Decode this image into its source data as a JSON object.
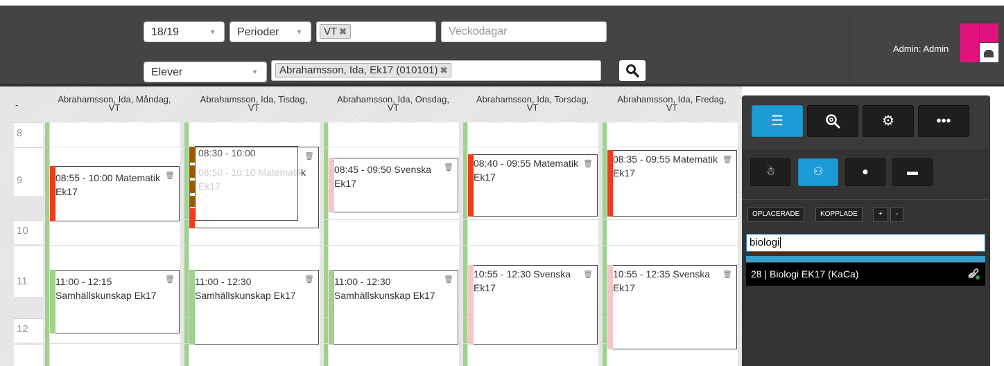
{
  "header": {
    "year_select": "18/19",
    "period_select": "Perioder",
    "period_tag": "VT",
    "weekdays_placeholder": "Veckodagar",
    "group_select": "Elever",
    "student_tag": "Abrahamsson, Ida, Ek17 (010101)",
    "admin_label": "Admin: Admin"
  },
  "calendar": {
    "corner": "-",
    "days": [
      {
        "header_line1": "Abrahamsson, Ida, Måndag,",
        "header_line2": "VT"
      },
      {
        "header_line1": "Abrahamsson, Ida, Tisdag,",
        "header_line2": "VT"
      },
      {
        "header_line1": "Abrahamsson, Ida, Onsdag,",
        "header_line2": "VT"
      },
      {
        "header_line1": "Abrahamsson, Ida, Torsdag,",
        "header_line2": "VT"
      },
      {
        "header_line1": "Abrahamsson, Ida, Fredag,",
        "header_line2": "VT"
      }
    ],
    "hours": [
      "8",
      "9",
      "10",
      "11",
      "12"
    ],
    "events": {
      "mon_1": {
        "line1": "08:55 - 10:00 Matematik",
        "line2": "Ek17"
      },
      "mon_2": {
        "line1": "11:00 - 12:15",
        "line2": "Samhällskunskap Ek17"
      },
      "tue_drag": {
        "line1": "08:30 - 10:00"
      },
      "tue_1": {
        "line1": "08:50 - 10:10 Matematik",
        "line2": "Ek17",
        "overflow": "k"
      },
      "tue_2": {
        "line1": "11:00 - 12:30",
        "line2": "Samhällskunskap Ek17"
      },
      "wed_1": {
        "line1": "08:45 - 09:50 Svenska",
        "line2": "Ek17"
      },
      "wed_2": {
        "line1": "11:00 - 12:30",
        "line2": "Samhällskunskap Ek17"
      },
      "thu_1": {
        "line1": "08:40 - 09:55 Matematik",
        "line2": "Ek17"
      },
      "thu_2": {
        "line1": "10:55 - 12:30 Svenska",
        "line2": "Ek17"
      },
      "fri_1": {
        "line1": "08:35 - 09:55 Matematik",
        "line2": "Ek17"
      },
      "fri_2": {
        "line1": "10:55 - 12:35 Svenska",
        "line2": "Ek17"
      }
    }
  },
  "panel": {
    "btn_unplaced": "OPLACERADE",
    "btn_linked": "KOPPLADE",
    "btn_plus": "+",
    "btn_minus": "-",
    "filter_value": "biologi",
    "result": "28 | Biologi EK17 (KaCa)"
  },
  "colors": {
    "accent_blue": "#1d9bd6",
    "brand_pink": "#e0137e",
    "math_red": "#f03c1e",
    "svenska_pink": "#f4c7c7",
    "samhall_green": "#9fd28c",
    "tuesday_brown": "#9a5a00"
  }
}
